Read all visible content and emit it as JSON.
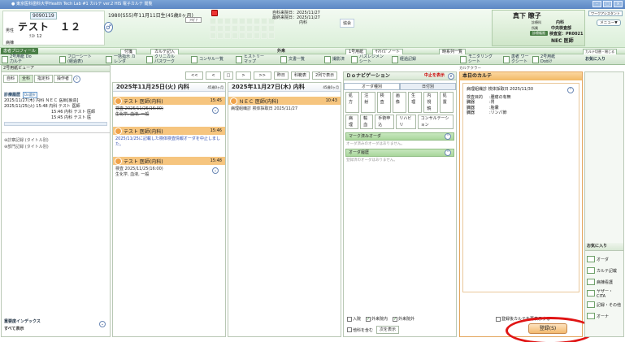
{
  "window": {
    "title": "● 東京医科歯科大学Health Tech Lab  #1  カルテ ver.2  HIS  電子カルテ  閲覧"
  },
  "patient": {
    "id": "9090119",
    "name": "テスト　１２",
    "kana": "ﾃｽﾄ 12",
    "status": "男性",
    "dob": "1980(S55)年11月11日生(45歳0ヶ月)",
    "first_visit": "自科来院日：2025/11/27",
    "last_visit": "最終来院日：2025/11/27",
    "dept": "内科",
    "ward": "病棟",
    "sex_symbol": "♂",
    "mode": "外来",
    "small_btn": "ﾌﾘｶﾞﾅ"
  },
  "user": {
    "name": "真下 瞭子",
    "role1": "診療科",
    "dept": "内科",
    "role2": "所属",
    "dept2": "中央検査部",
    "role3": "診療権限",
    "label": "検査室：PR0021",
    "doctor": "NEC 医師",
    "top_right": "ワークアシスタント",
    "menu": "メニュー▼",
    "fav": "お気に入り"
  },
  "menubar": {
    "items": [
      "患者プロフィール",
      "付箋",
      "カルテ記入",
      "外来",
      "1号用紙",
      "ｻﾏﾘｲｽﾞノート",
      "時系列一覧",
      "カルテ切替・閉じる"
    ]
  },
  "toolbar": {
    "buttons": [
      "2号用紙 Do力ルテ",
      "フローシート (経過表)",
      "一括指示 カレンダ",
      "クリニカル パスワーク",
      "コンサル一覧",
      "ヒストリー マップ",
      "文書一覧",
      "撮影済",
      "バスレジメン シート",
      "経過記録",
      "モニタリング シート",
      "患者 ワークシート",
      "2号用紙 Doｶﾙﾃ",
      "お気に入り"
    ]
  },
  "left": {
    "title": "2号用紙ビューア",
    "tabs": [
      "自科",
      "全科",
      "指定科",
      "操作者"
    ],
    "label1": "診療履歴",
    "badge": "Do選択",
    "rows": [
      "2025/11/27(木) 内科 ＮＥＣ 医師[製造]",
      "2025/11/25(火) 15:48 内科 テスト 医師",
      "15:46 内科 テスト 医師",
      "15:45 内科 テスト 医"
    ],
    "tree1": "⊕診察記録 (タイトル別)",
    "tree2": "⊕部門記録 (タイトル別)",
    "index_label": "重要度インデックス",
    "index_value": "すべて表示"
  },
  "nav": {
    "prev2": "<<",
    "prev": "<",
    "mid": "□",
    ">": ">",
    "next2": ">>",
    "today": "昨日",
    "dept": "科範表",
    "show": "2列で表示"
  },
  "col1": {
    "date": "2025年11月25日(火) 内科",
    "age": "45歳0ヶ月",
    "e1_name": "テスト 医師(内科)",
    "e1_time": "15:45",
    "e1_l1": "検査-2025/11/25(16:00)",
    "e1_l2": "生化学, 血液, 一般",
    "e2_name": "テスト 医師(内科)",
    "e2_time": "15:46",
    "e2_text": "2025/11/25に記載した検体検査情報オーダを中止しました。",
    "e3_name": "テスト 医師(内科)",
    "e3_time": "15:48",
    "e3_l1": "検査 2025/11/25(16:00)",
    "e3_l2": "生化学, 血液, 一般"
  },
  "col2": {
    "date": "2025年11月27日(木) 内科",
    "age": "45歳0ヶ月",
    "e1_name": "ＮＥＣ 医師(内科)",
    "e1_time": "10:43",
    "e1_l1": "病理組織診 検体採取日 2025/11/27"
  },
  "do_nav": {
    "title": "Ｄｏナビゲーション",
    "stop": "中止を表示",
    "tab1": "オーダ種別",
    "tab2": "日付別",
    "cats": [
      "処方",
      "注射",
      "検査",
      "画像",
      "生理",
      "内視鏡",
      "処置",
      "病理",
      "輸血",
      "手術申込",
      "リハビリ",
      "コンサルテーション"
    ],
    "sec1": "マーク済みオーダ",
    "sec1_text": "オーダ済みのオーダはありません。",
    "sec2": "オーダ履歴",
    "sec2_text": "登録済のオーダはありません。",
    "chk1": "入院",
    "chk2": "外来院内",
    "chk3": "外来院外",
    "chk4": "他科を含む",
    "more": "次を表示"
  },
  "karte": {
    "tab": "カルテクラー",
    "title": "本日のカルテ",
    "l1": "病理組織診 検体採取日 2025/11/30",
    "l2k": "検査目的",
    "l2v": ":腫瘍の有無",
    "l3k": "臓器",
    "l3v": ":胃",
    "l4k": "臓器",
    "l4v": ":胎嚢",
    "l5k": "臓器",
    "l5v": ":リンパ節",
    "reuse": "登録後カルテを再表示する",
    "register": "登録(S)"
  },
  "side": {
    "title": "お気に入り",
    "items": [
      "オーダ",
      "カルテ記載",
      "病棟看護",
      "ヤザー・CITA",
      "記録・その他",
      "オーナ"
    ]
  }
}
